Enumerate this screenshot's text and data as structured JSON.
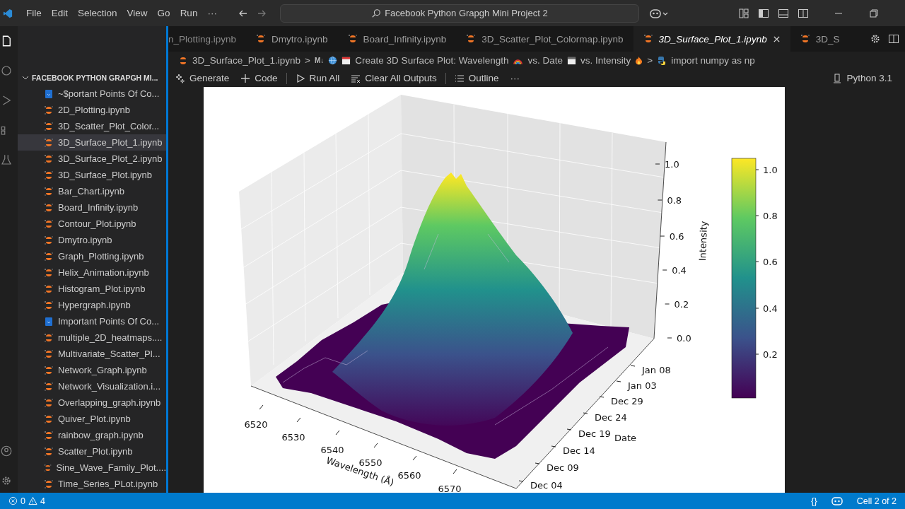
{
  "menu": [
    "File",
    "Edit",
    "Selection",
    "View",
    "Go",
    "Run",
    "···"
  ],
  "search": {
    "value": "Facebook Python Grapgh Mini Project 2"
  },
  "explorer": {
    "title": "FACEBOOK PYTHON GRAPGH MI...",
    "items": [
      {
        "label": "~$portant Points Of Co...",
        "kind": "doc",
        "selected": false
      },
      {
        "label": "2D_Plotting.ipynb",
        "kind": "notebook",
        "selected": false
      },
      {
        "label": "3D_Scatter_Plot_Color...",
        "kind": "notebook",
        "selected": false
      },
      {
        "label": "3D_Surface_Plot_1.ipynb",
        "kind": "notebook",
        "selected": true
      },
      {
        "label": "3D_Surface_Plot_2.ipynb",
        "kind": "notebook",
        "selected": false
      },
      {
        "label": "3D_Surface_Plot.ipynb",
        "kind": "notebook",
        "selected": false
      },
      {
        "label": "Bar_Chart.ipynb",
        "kind": "notebook",
        "selected": false
      },
      {
        "label": "Board_Infinity.ipynb",
        "kind": "notebook",
        "selected": false
      },
      {
        "label": "Contour_Plot.ipynb",
        "kind": "notebook",
        "selected": false
      },
      {
        "label": "Dmytro.ipynb",
        "kind": "notebook",
        "selected": false
      },
      {
        "label": "Graph_Plotting.ipynb",
        "kind": "notebook",
        "selected": false
      },
      {
        "label": "Helix_Animation.ipynb",
        "kind": "notebook",
        "selected": false
      },
      {
        "label": "Histogram_Plot.ipynb",
        "kind": "notebook",
        "selected": false
      },
      {
        "label": "Hypergraph.ipynb",
        "kind": "notebook",
        "selected": false
      },
      {
        "label": "Important Points Of Co...",
        "kind": "doc",
        "selected": false
      },
      {
        "label": "multiple_2D_heatmaps....",
        "kind": "notebook",
        "selected": false
      },
      {
        "label": "Multivariate_Scatter_Pl...",
        "kind": "notebook",
        "selected": false
      },
      {
        "label": "Network_Graph.ipynb",
        "kind": "notebook",
        "selected": false
      },
      {
        "label": "Network_Visualization.i...",
        "kind": "notebook",
        "selected": false
      },
      {
        "label": "Overlapping_graph.ipynb",
        "kind": "notebook",
        "selected": false
      },
      {
        "label": "Quiver_Plot.ipynb",
        "kind": "notebook",
        "selected": false
      },
      {
        "label": "rainbow_graph.ipynb",
        "kind": "notebook",
        "selected": false
      },
      {
        "label": "Scatter_Plot.ipynb",
        "kind": "notebook",
        "selected": false
      },
      {
        "label": "Sine_Wave_Family_Plot....",
        "kind": "notebook",
        "selected": false
      },
      {
        "label": "Time_Series_PLot.ipynb",
        "kind": "notebook",
        "selected": false
      }
    ]
  },
  "tabs": [
    {
      "label": "n_Plotting.ipynb",
      "selected": false,
      "icon": false
    },
    {
      "label": "Dmytro.ipynb",
      "selected": false,
      "icon": true
    },
    {
      "label": "Board_Infinity.ipynb",
      "selected": false,
      "icon": true
    },
    {
      "label": "3D_Scatter_Plot_Colormap.ipynb",
      "selected": false,
      "icon": true
    },
    {
      "label": "3D_Surface_Plot_1.ipynb",
      "selected": true,
      "icon": true
    },
    {
      "label": "3D_S",
      "selected": false,
      "icon": true
    }
  ],
  "breadcrumb": {
    "file": "3D_Surface_Plot_1.ipynb",
    "separator": ">",
    "markdown": "M↓",
    "heading_parts": [
      "Create 3D Surface Plot: Wavelength",
      "vs. Date",
      "vs. Intensity"
    ],
    "cell": "import numpy as np"
  },
  "toolbar": {
    "items": [
      "Generate",
      "Code",
      "Run All",
      "Clear All Outputs",
      "Outline",
      "···"
    ],
    "kernel": "Python 3.1"
  },
  "plot": {
    "z_label": "Intensity",
    "z_ticks": [
      "1.0",
      "0.8",
      "0.6",
      "0.4",
      "0.2",
      "0.0"
    ],
    "x_label": "Wavelength (Å)",
    "x_ticks": [
      "6520",
      "6530",
      "6540",
      "6550",
      "6560",
      "6570"
    ],
    "y_label": "Date",
    "y_ticks": [
      "Jan 08",
      "Jan 03",
      "Dec 29",
      "Dec 24",
      "Dec 19",
      "Dec 14",
      "Dec 09",
      "Dec 04"
    ],
    "colorbar_ticks": [
      "1.0",
      "0.8",
      "0.6",
      "0.4",
      "0.2"
    ]
  },
  "status_bar": {
    "errors": "0",
    "warnings": "4",
    "braces": "{}",
    "cell": "Cell 2 of 2"
  }
}
